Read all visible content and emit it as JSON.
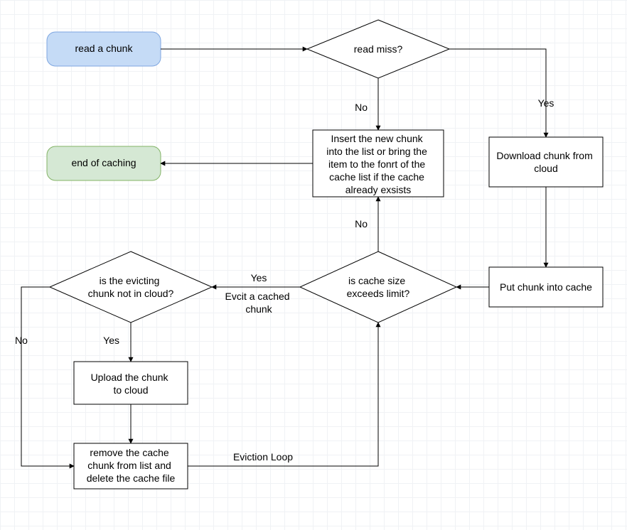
{
  "nodes": {
    "read_chunk": "read a chunk",
    "read_miss": "read miss?",
    "insert1": "Insert the new chunk",
    "insert2": "into the list or bring the",
    "insert3": "item to the fonrt of the",
    "insert4": "cache list if the cache",
    "insert5": "already exsists",
    "end_caching": "end of caching",
    "download1": "Download chunk from",
    "download2": "cloud",
    "put_cache": "Put chunk into cache",
    "size1": "is cache size",
    "size2": "exceeds limit?",
    "evict1": "is the evicting",
    "evict2": "chunk not in cloud?",
    "upload1": "Upload the chunk",
    "upload2": "to cloud",
    "remove1": "remove the cache",
    "remove2": "chunk from list and",
    "remove3": "delete the cache file"
  },
  "labels": {
    "yes_top": "Yes",
    "no_top": "No",
    "no_mid": "No",
    "yes_mid": "Yes",
    "evict_sub1": "Evcit a cached",
    "evict_sub2": "chunk",
    "no_left": "No",
    "yes_left": "Yes",
    "loop": "Eviction Loop"
  },
  "colors": {
    "blue_fill": "#c5dbf6",
    "blue_stroke": "#7ea6e0",
    "green_fill": "#d5e8d4",
    "green_stroke": "#82b366",
    "stroke": "#000000"
  }
}
